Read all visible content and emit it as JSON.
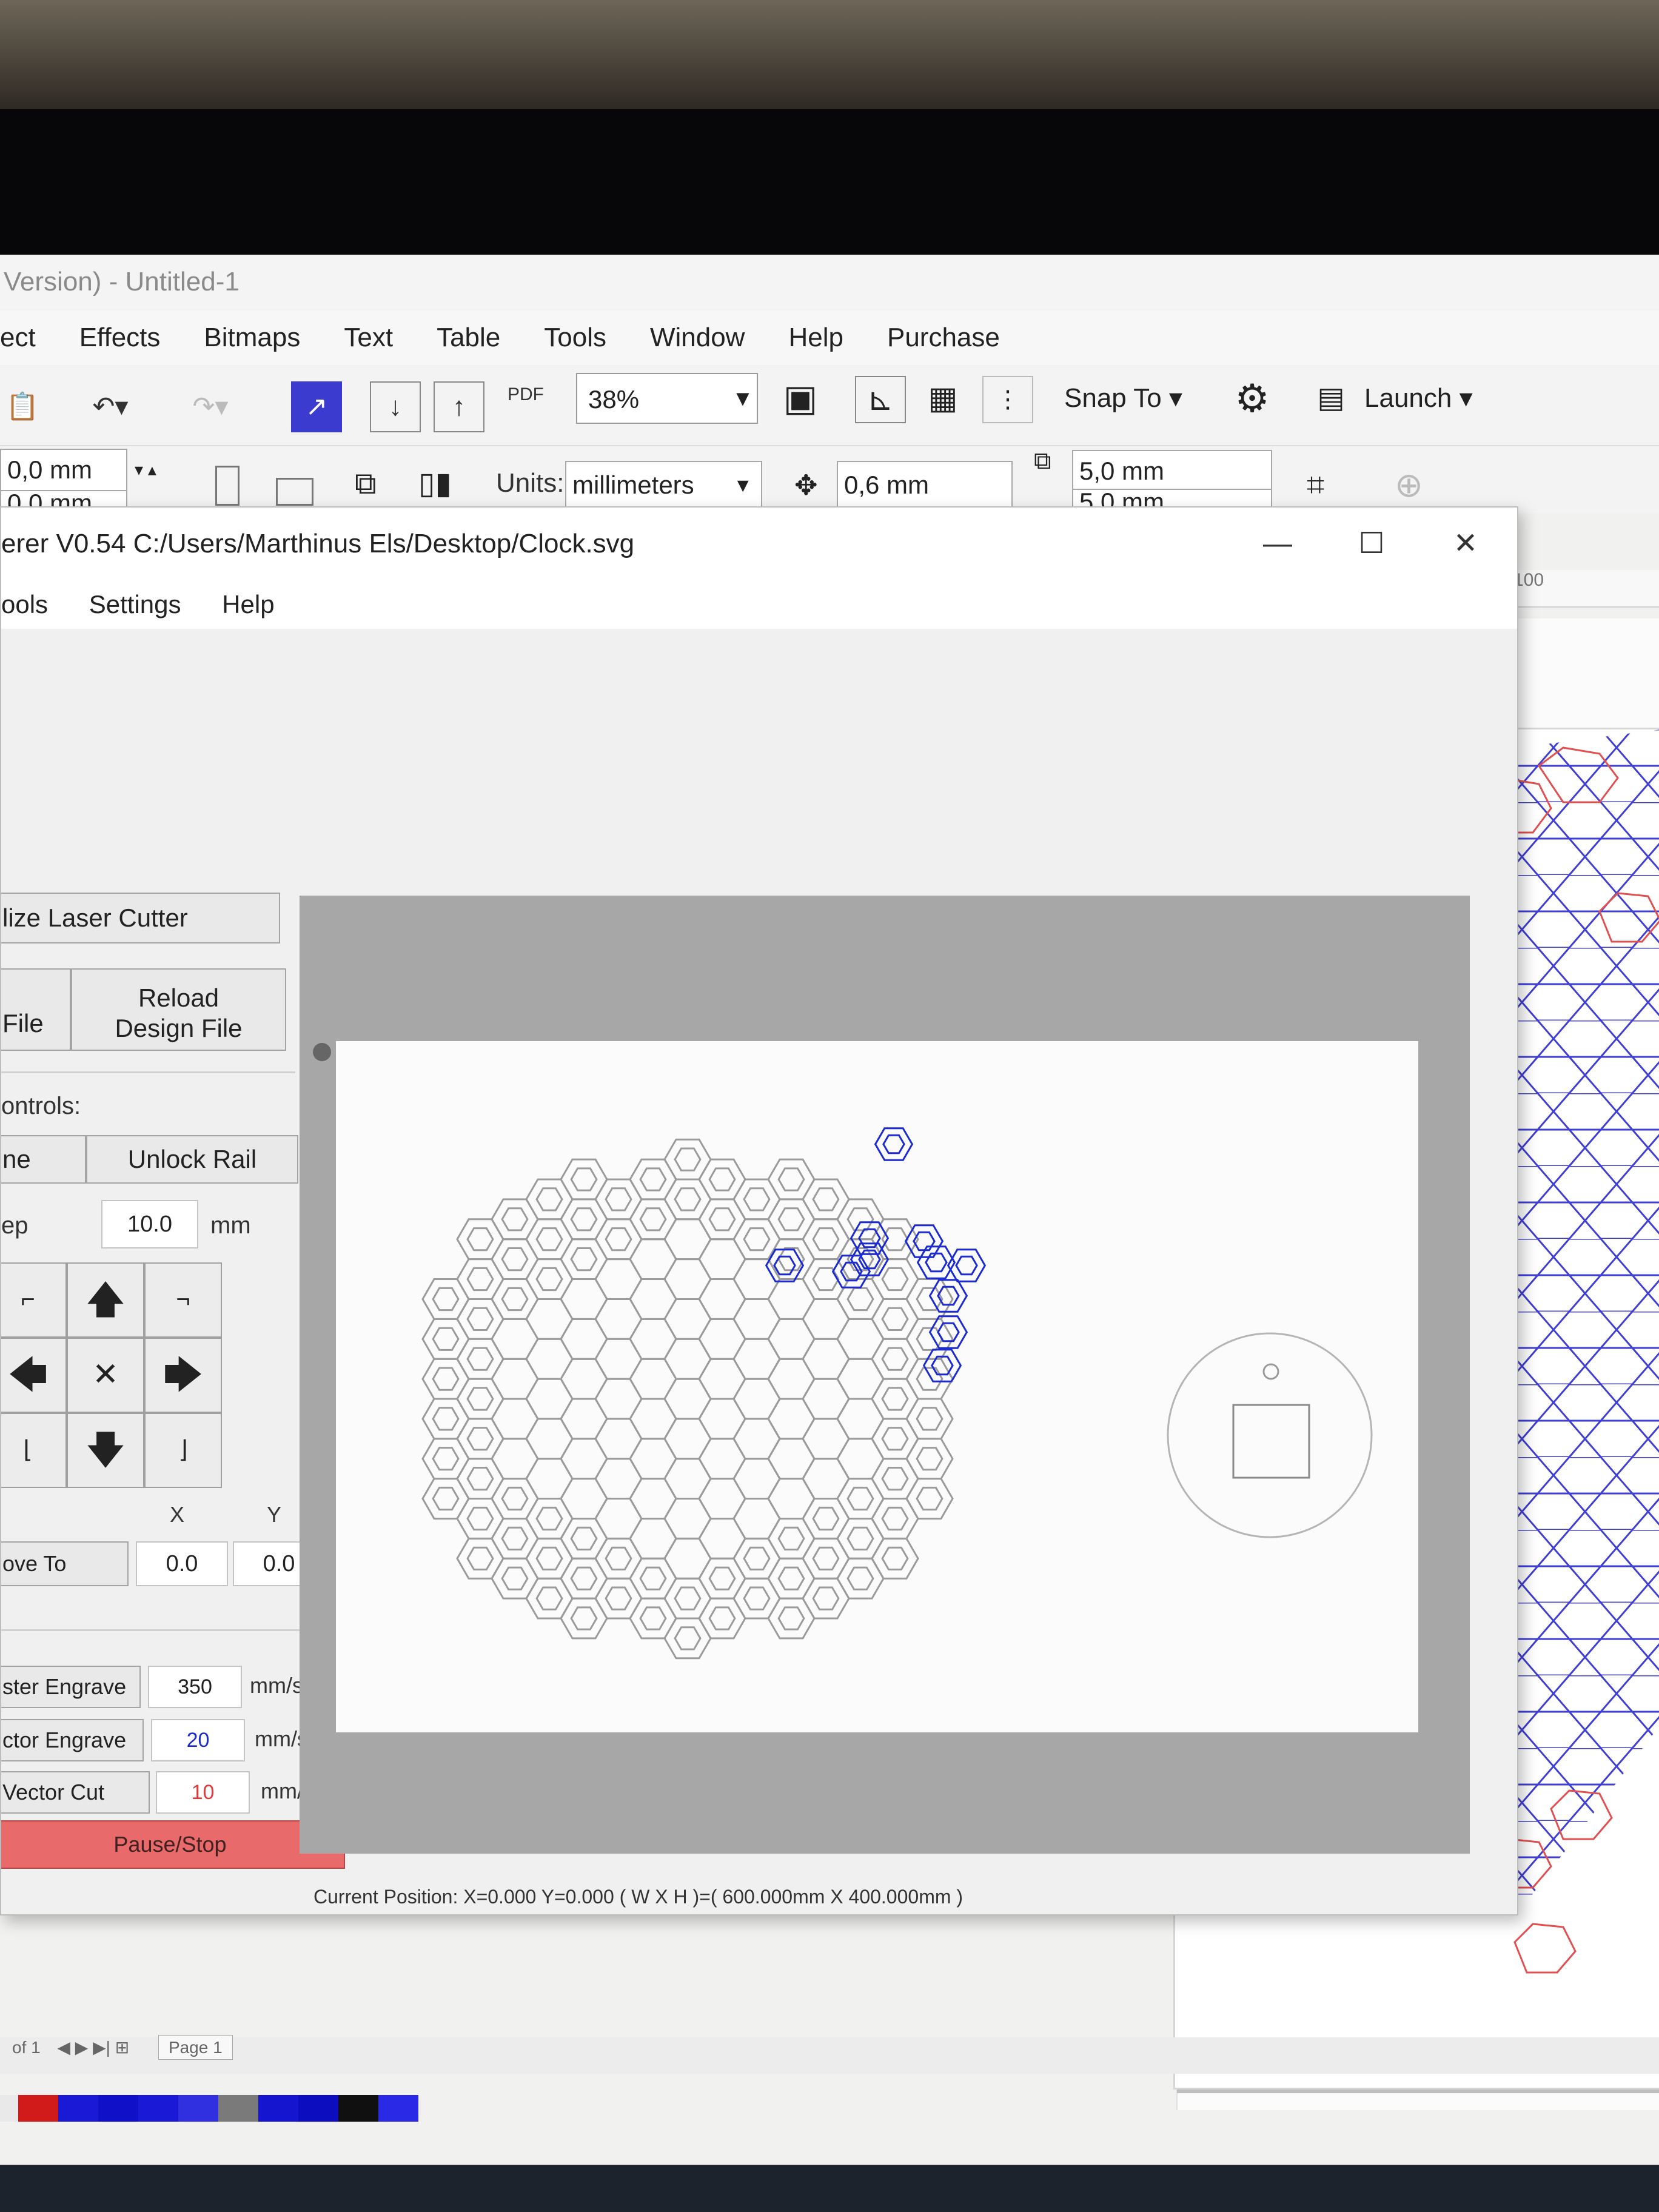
{
  "bg_app": {
    "title": "Version) - Untitled-1",
    "menu": [
      "ect",
      "Effects",
      "Bitmaps",
      "Text",
      "Table",
      "Tools",
      "Window",
      "Help",
      "Purchase"
    ],
    "toolbar": {
      "zoom": "38%",
      "pdf_label": "PDF",
      "snap_label": "Snap To",
      "launch_label": "Launch"
    },
    "propbar": {
      "pos_x": "0,0 mm",
      "pos_y": "0,0 mm",
      "units_label": "Units:",
      "units_value": "millimeters",
      "nudge": "0,6 mm",
      "dup_x": "5,0 mm",
      "dup_y": "5,0 mm"
    },
    "ruler_value": "100",
    "status": {
      "pages": "of 1",
      "page_tab": "Page 1"
    },
    "palette": [
      "#e9e9e9",
      "#d11a1a",
      "#1a1ad6",
      "#1010c8",
      "#1a1ad6",
      "#3030e0",
      "#7a7a7a",
      "#1515cf",
      "#0d0dc0",
      "#101010",
      "#2a2ae6"
    ]
  },
  "k40": {
    "title": "erer V0.54   C:/Users/Marthinus Els/Desktop/Clock.svg",
    "menu": [
      "ools",
      "Settings",
      "Help"
    ],
    "init_button": "lize Laser Cutter",
    "open_button": "File",
    "reload_button_line1": "Reload",
    "reload_button_line2": "Design File",
    "controls_label": "ontrols:",
    "home_button": "ne",
    "unlock_button": "Unlock Rail",
    "step_label": "ep",
    "step_value": "10.0",
    "step_unit": "mm",
    "x_label": "X",
    "y_label": "Y",
    "move_to_button": "ove To",
    "move_x": "0.0",
    "move_y": "0.0",
    "raster_button": "ster Engrave",
    "raster_speed": "350",
    "vector_engrave_button": "ctor Engrave",
    "vector_engrave_speed": "20",
    "vector_cut_button": "Vector Cut",
    "vector_cut_speed": "10",
    "speed_unit": "mm/s",
    "pause_button": "Pause/Stop",
    "status": "Current Position: X=0.000 Y=0.000    ( W X H )=( 600.000mm X 400.000mm )",
    "colors": {
      "pause": "#e86a6a",
      "engrave_blue": "#1c2bd0",
      "cut_red": "#e03a3a",
      "design_gray": "#9b9b9b"
    }
  }
}
